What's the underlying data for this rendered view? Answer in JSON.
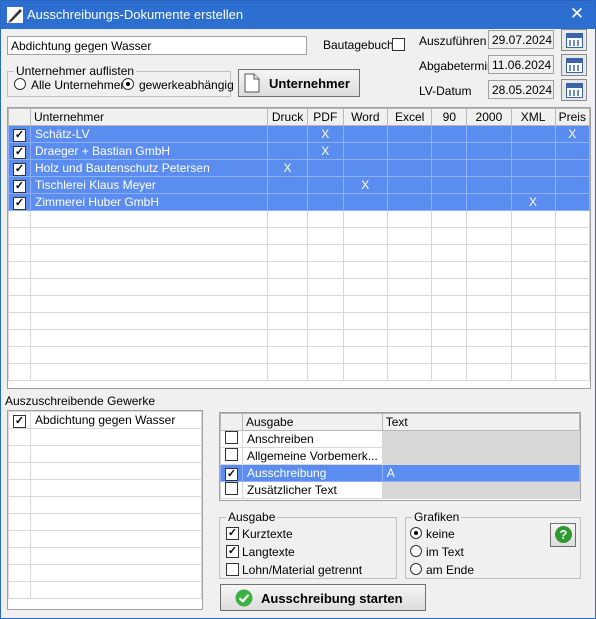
{
  "window": {
    "title": "Ausschreibungs-Dokumente erstellen",
    "close_glyph": "✕"
  },
  "project_name": "Abdichtung gegen Wasser",
  "bautagebuch": {
    "label": "Bautagebuch",
    "checked": false
  },
  "dates": {
    "auszufuehren": {
      "label": "Auszuführen",
      "value": "29.07.2024"
    },
    "abgabetermin": {
      "label": "Abgabetermin",
      "value": "11.06.2024"
    },
    "lv_datum": {
      "label": "LV-Datum",
      "value": "28.05.2024"
    }
  },
  "list_group": {
    "label": "Unternehmer auflisten",
    "opt_all": "Alle Unternehmer",
    "opt_trade": "gewerkeabhängig",
    "selected": "gewerkeabhängig"
  },
  "unternehmer_button": "Unternehmer",
  "company_table": {
    "columns": [
      "Unternehmer",
      "Druck",
      "PDF",
      "Word",
      "Excel",
      "90",
      "2000",
      "XML",
      "Preis"
    ],
    "rows": [
      {
        "name": "Schätz-LV",
        "marks": [
          "",
          "X",
          "",
          "",
          "",
          "",
          "",
          "X"
        ]
      },
      {
        "name": "Draeger + Bastian GmbH",
        "marks": [
          "",
          "X",
          "",
          "",
          "",
          "",
          "",
          ""
        ]
      },
      {
        "name": "Holz und Bautenschutz Petersen",
        "marks": [
          "X",
          "",
          "",
          "",
          "",
          "",
          "",
          ""
        ]
      },
      {
        "name": "Tischlerei Klaus Meyer",
        "marks": [
          "",
          "",
          "X",
          "",
          "",
          "",
          "",
          ""
        ]
      },
      {
        "name": "Zimmerei Huber GmbH",
        "marks": [
          "",
          "",
          "",
          "",
          "",
          "",
          "X",
          ""
        ]
      }
    ]
  },
  "gewerke": {
    "label": "Auszuschreibende Gewerke",
    "items": [
      {
        "label": "Abdichtung gegen Wasser",
        "checked": true
      }
    ]
  },
  "output_table": {
    "columns": [
      "Ausgabe",
      "Text"
    ],
    "rows": [
      {
        "label": "Anschreiben",
        "text": "",
        "checked": false
      },
      {
        "label": "Allgemeine Vorbemerk...",
        "text": "",
        "checked": false
      },
      {
        "label": "Ausschreibung",
        "text": "A",
        "checked": true
      },
      {
        "label": "Zusätzlicher Text",
        "text": "",
        "checked": false
      }
    ]
  },
  "ausgabe_group": {
    "label": "Ausgabe",
    "kurztexte": "Kurztexte",
    "langtexte": "Langtexte",
    "lohn": "Lohn/Material getrennt"
  },
  "grafiken_group": {
    "label": "Grafiken",
    "keine": "keine",
    "im_text": "im Text",
    "am_ende": "am Ende",
    "selected": "keine"
  },
  "help_glyph": "?",
  "start_button": "Ausschreibung starten",
  "colors": {
    "title_bar": "#2d6fd0",
    "selection": "#5b8df0",
    "help_green": "#2e9a2e",
    "start_green": "#3cb043"
  }
}
